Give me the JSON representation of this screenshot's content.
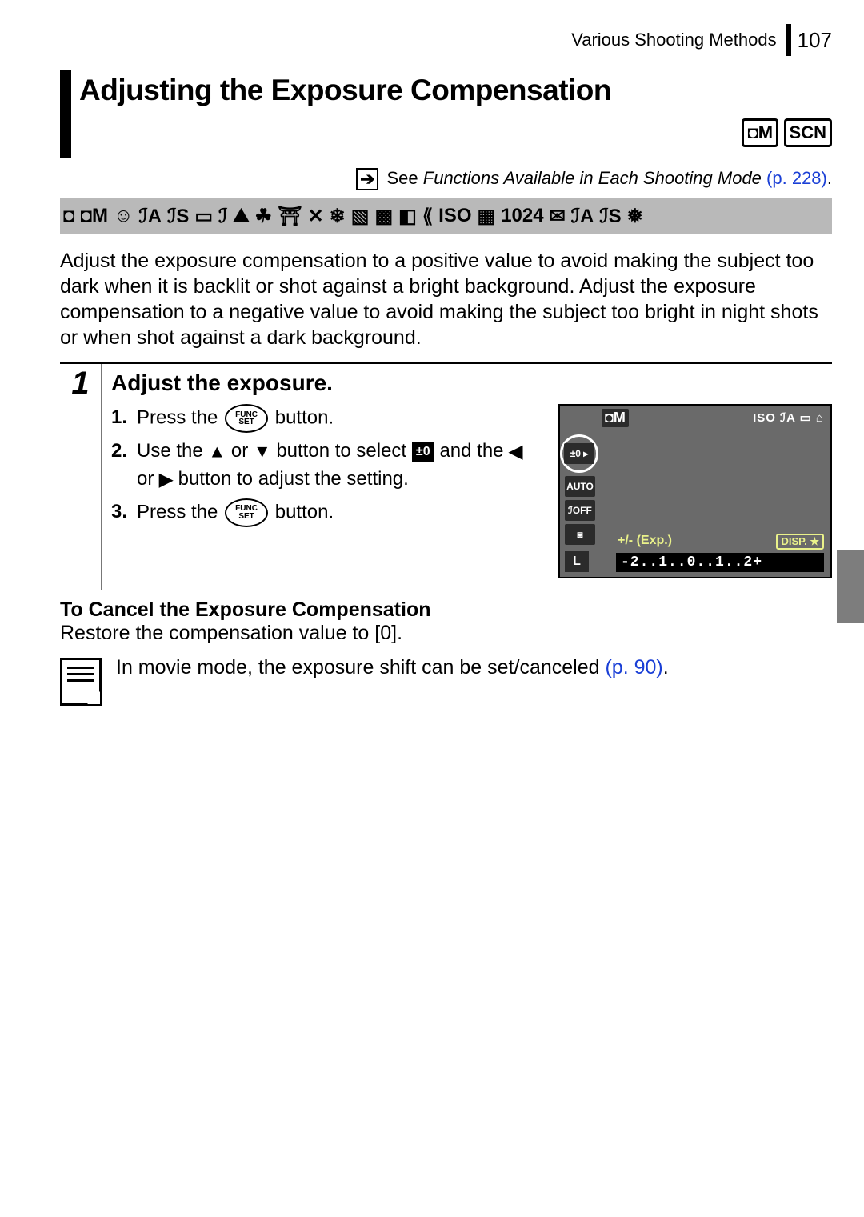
{
  "header": {
    "section": "Various Shooting Methods",
    "page_number": "107"
  },
  "title": "Adjusting the Exposure Compensation",
  "mode_badges": {
    "cam_m": "◘M",
    "scn": "SCN"
  },
  "see_ref": {
    "prefix": "See ",
    "text": "Functions Available in Each Shooting Mode ",
    "page": "(p. 228)",
    "period": "."
  },
  "mode_strip": [
    "◘",
    "◘M",
    "☺",
    "ℐA",
    "ℐS",
    "▭",
    "ℐ",
    "⛰",
    "☘",
    "⛩",
    "✕",
    "❄",
    "▧",
    "▩",
    "◧",
    "⟪",
    "ISO",
    "▦",
    "1024",
    "✉",
    "ℐA",
    "ℐS",
    "❅"
  ],
  "intro": "Adjust the exposure compensation to a positive value to avoid making the subject too dark when it is backlit or shot against a bright background. Adjust the exposure compensation to a negative value to avoid making the subject too bright in night shots or when shot against a dark background.",
  "step": {
    "number": "1",
    "title": "Adjust the exposure.",
    "items": {
      "i1_a": "Press the ",
      "i1_b": " button.",
      "i2_a": "Use the ",
      "i2_b": " or ",
      "i2_c": " button to select ",
      "i2_d": " and the ",
      "i2_e": " or ",
      "i2_f": " button to adjust the setting.",
      "i3_a": "Press the ",
      "i3_b": " button."
    },
    "func_top": "FUNC",
    "func_bot": "SET",
    "ev_icon": "±0"
  },
  "lcd": {
    "mode": "◘M",
    "top_right": "ISO ℐA ▭ ⌂",
    "circled": "±0 ▸",
    "left": [
      "AUTO",
      "ℐOFF",
      "◙"
    ],
    "l": "L",
    "exp_label": "+/- (Exp.)",
    "disp": "DISP.",
    "scale": "-2..1..0..1..2+"
  },
  "cancel": {
    "title": "To Cancel the Exposure Compensation",
    "text": "Restore the compensation value to [0]."
  },
  "note": {
    "text": "In movie mode, the exposure shift can be set/canceled ",
    "page": "(p. 90)",
    "period": "."
  }
}
